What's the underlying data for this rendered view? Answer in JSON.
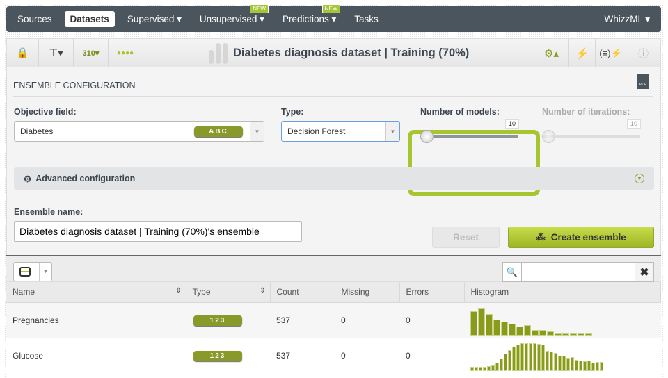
{
  "nav": {
    "items": [
      {
        "label": "Sources"
      },
      {
        "label": "Datasets",
        "active": true
      },
      {
        "label": "Supervised ▾"
      },
      {
        "label": "Unsupervised ▾",
        "badge": "NEW"
      },
      {
        "label": "Predictions ▾",
        "badge": "NEW"
      },
      {
        "label": "Tasks"
      }
    ],
    "right": "WhizzML ▾"
  },
  "toolbar": {
    "title": "Diabetes diagnosis dataset | Training (70%)"
  },
  "config": {
    "section": "ENSEMBLE CONFIGURATION",
    "objective_label": "Objective field:",
    "objective_value": "Diabetes",
    "objective_type": "ABC",
    "type_label": "Type:",
    "type_value": "Decision Forest",
    "models_label": "Number of models:",
    "models_value": "10",
    "iterations_label": "Number of iterations:",
    "iterations_value": "10",
    "advanced": "Advanced configuration",
    "name_label": "Ensemble name:",
    "name_value": "Diabetes diagnosis dataset | Training (70%)'s ensemble",
    "reset": "Reset",
    "create": "Create ensemble",
    "pdf": "PDF"
  },
  "colors": {
    "accent": "#a6c52f",
    "badge": "#8a9a2a",
    "nav": "#4a555e"
  },
  "table": {
    "headers": [
      "Name",
      "Type",
      "Count",
      "Missing",
      "Errors",
      "Histogram"
    ],
    "rows": [
      {
        "name": "Pregnancies",
        "type": "123",
        "count": "537",
        "missing": "0",
        "errors": "0",
        "histogram": [
          102,
          117,
          89,
          68,
          58,
          48,
          36,
          42,
          22,
          22,
          18,
          11,
          11,
          11,
          11,
          11
        ]
      },
      {
        "name": "Glucose",
        "type": "123",
        "count": "537",
        "missing": "0",
        "errors": "0",
        "histogram": [
          15,
          15,
          15,
          17,
          20,
          23,
          32,
          50,
          72,
          87,
          101,
          108,
          116,
          116,
          116,
          116,
          113,
          110,
          83,
          80,
          74,
          63,
          63,
          53,
          56,
          44,
          41,
          38,
          41,
          32,
          35,
          35
        ]
      }
    ]
  }
}
